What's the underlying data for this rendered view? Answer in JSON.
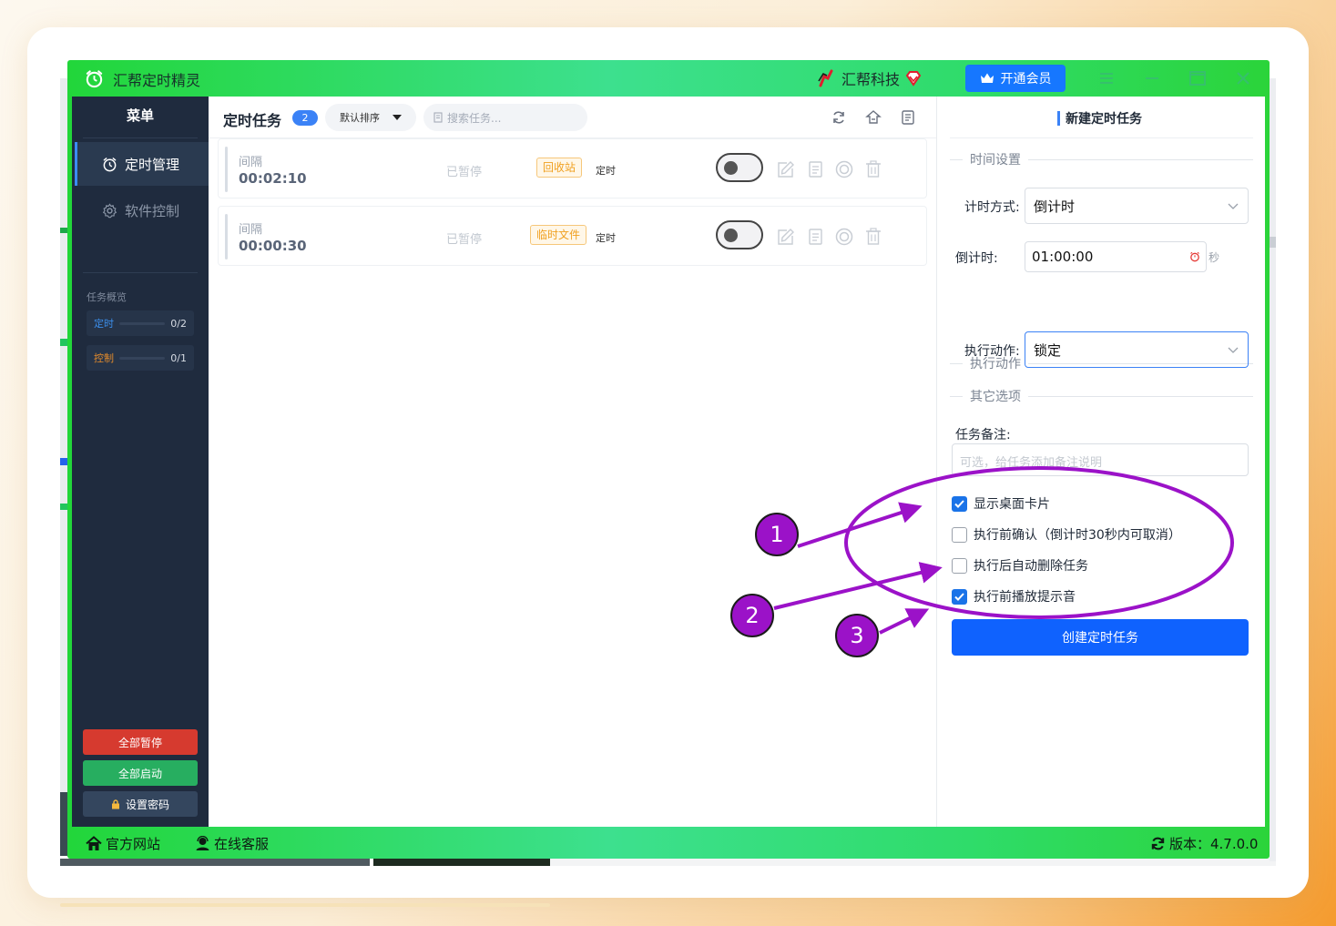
{
  "app": {
    "title": "汇帮定时精灵",
    "brand": "汇帮科技",
    "vip_label": "开通会员",
    "colors": {
      "accent": "#1677ff",
      "sidebar": "#1f2b3e",
      "titlebar": "#2bd43a",
      "annotation": "#9b12c8"
    }
  },
  "sidebar": {
    "title": "菜单",
    "items": [
      {
        "label": "定时管理",
        "icon": "alarm-clock-icon",
        "active": true
      },
      {
        "label": "软件控制",
        "icon": "gear-icon",
        "active": false
      }
    ],
    "overview_label": "任务概览",
    "overview": [
      {
        "label": "定时",
        "count": "0/2",
        "color": "#3b8eea"
      },
      {
        "label": "控制",
        "count": "0/1",
        "color": "#e38b2c"
      }
    ],
    "buttons": {
      "pause_all": "全部暂停",
      "start_all": "全部启动",
      "set_password": "设置密码"
    }
  },
  "main": {
    "title": "定时任务",
    "count": "2",
    "sort_label": "默认排序",
    "search_placeholder": "搜索任务..."
  },
  "tasks": [
    {
      "type": "间隔",
      "time": "00:02:10",
      "status": "已暂停",
      "tag": "回收站",
      "kind": "定时",
      "enabled": false
    },
    {
      "type": "间隔",
      "time": "00:00:30",
      "status": "已暂停",
      "tag": "临时文件",
      "kind": "定时",
      "enabled": false
    }
  ],
  "form": {
    "title": "新建定时任务",
    "section_time": "时间设置",
    "mode_label": "计时方式:",
    "mode_value": "倒计时",
    "countdown_label": "倒计时:",
    "countdown_value": "01:00:00",
    "seconds_unit": "秒",
    "section_action": "执行动作",
    "action_label": "执行动作:",
    "action_value": "锁定",
    "section_other": "其它选项",
    "note_label": "任务备注:",
    "note_placeholder": "可选，给任务添加备注说明",
    "options": [
      {
        "label": "显示桌面卡片",
        "checked": true
      },
      {
        "label": "执行前确认（倒计时30秒内可取消）",
        "checked": false
      },
      {
        "label": "执行后自动删除任务",
        "checked": false
      },
      {
        "label": "执行前播放提示音",
        "checked": true
      }
    ],
    "create_button": "创建定时任务"
  },
  "statusbar": {
    "website": "官方网站",
    "support": "在线客服",
    "version": "版本：4.7.0.0"
  },
  "annotations": [
    "1",
    "2",
    "3"
  ]
}
